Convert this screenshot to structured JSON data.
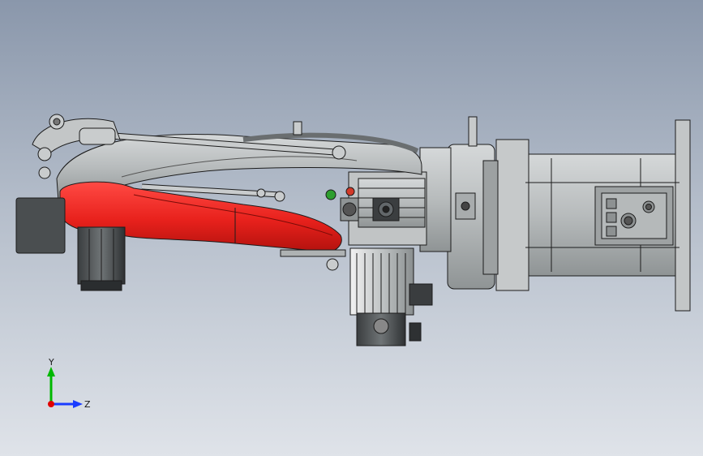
{
  "viewport": {
    "colors": {
      "background_top": "#8a97ab",
      "background_bottom": "#dfe3e9",
      "part_gray": "#b9bdbe",
      "part_red": "#e8211c",
      "edge": "#1c1c1c"
    }
  },
  "triad": {
    "y_label": "Y",
    "z_label": "Z",
    "colors": {
      "y_axis": "#00b800",
      "z_axis": "#1a3cff",
      "x_axis": "#e00000"
    }
  }
}
